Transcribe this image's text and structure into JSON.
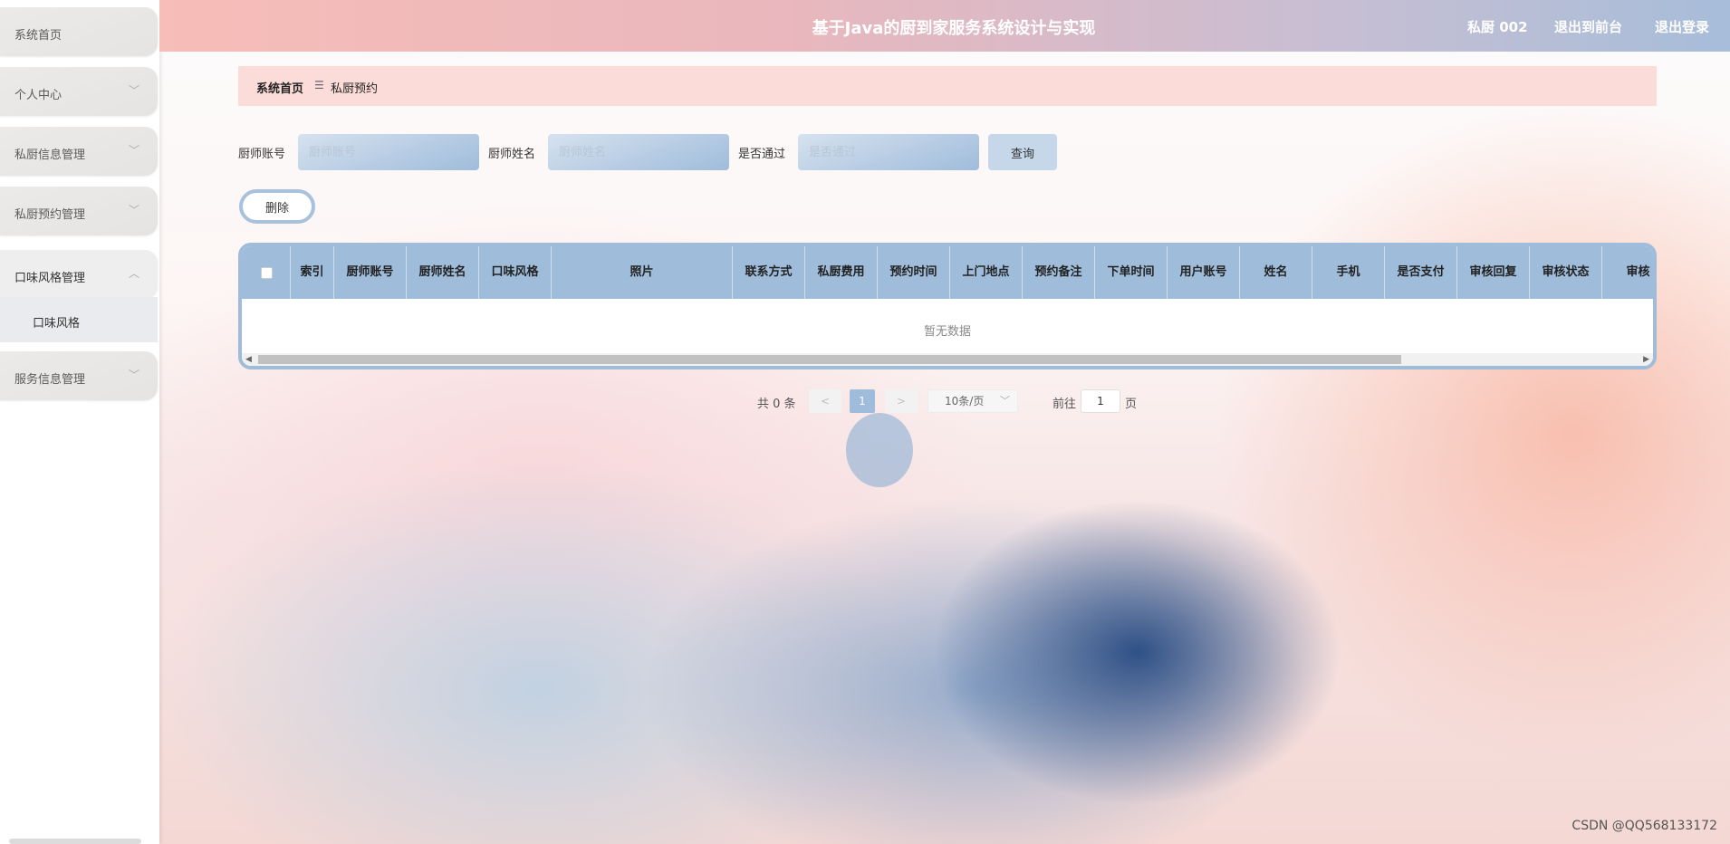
{
  "header": {
    "title": "基于Java的厨到家服务系统设计与实现",
    "user": "私厨 002",
    "exit_front": "退出到前台",
    "logout": "退出登录"
  },
  "sidebar": {
    "items": [
      {
        "label": "系统首页"
      },
      {
        "label": "个人中心",
        "chevron": "chevron-down-icon"
      },
      {
        "label": "私厨信息管理",
        "chevron": "chevron-down-icon"
      },
      {
        "label": "私厨预约管理",
        "chevron": "chevron-down-icon"
      },
      {
        "label": "口味风格管理",
        "chevron": "chevron-up-icon",
        "expanded": true
      },
      {
        "label": "服务信息管理",
        "chevron": "chevron-down-icon"
      }
    ],
    "submenu": {
      "label": "口味风格"
    }
  },
  "breadcrumb": {
    "home": "系统首页",
    "separator": "☰",
    "current": "私厨预约"
  },
  "search": {
    "chef_account": {
      "label": "厨师账号",
      "placeholder": "厨师账号"
    },
    "chef_name": {
      "label": "厨师姓名",
      "placeholder": "厨师姓名"
    },
    "approved": {
      "label": "是否通过",
      "placeholder": "是否通过"
    },
    "query_label": "查询"
  },
  "actions": {
    "delete_label": "删除"
  },
  "table": {
    "columns": [
      "索引",
      "厨师账号",
      "厨师姓名",
      "口味风格",
      "照片",
      "联系方式",
      "私厨费用",
      "预约时间",
      "上门地点",
      "预约备注",
      "下单时间",
      "用户账号",
      "姓名",
      "手机",
      "是否支付",
      "审核回复",
      "审核状态",
      "审核"
    ],
    "rows": [],
    "empty_text": "暂无数据"
  },
  "pagination": {
    "total_text": "共 0 条",
    "prev": "<",
    "current_page": "1",
    "next": ">",
    "page_size": "10条/页",
    "goto_prefix": "前往",
    "goto_value": "1",
    "goto_suffix": "页"
  },
  "watermark": "CSDN @QQ568133172",
  "colors": {
    "accent": "#9fbcdb",
    "header_start": "#f7bdb8",
    "header_end": "#a7bdd9",
    "breadcrumb_bg": "#fcdcd8"
  }
}
